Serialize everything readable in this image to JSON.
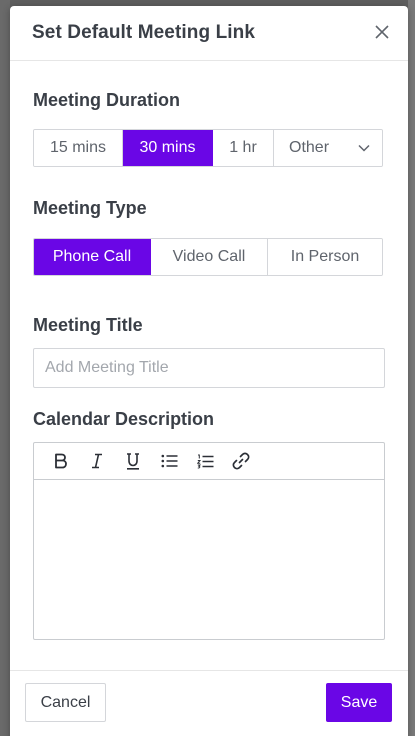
{
  "modal": {
    "title": "Set Default Meeting Link",
    "close_icon": "close-icon"
  },
  "duration": {
    "label": "Meeting Duration",
    "options": [
      "15 mins",
      "30 mins",
      "1 hr"
    ],
    "selected": "30 mins",
    "other_select": {
      "value": "Other",
      "icon": "chevron-down-icon"
    }
  },
  "type": {
    "label": "Meeting Type",
    "options": [
      "Phone Call",
      "Video Call",
      "In Person"
    ],
    "selected": "Phone Call"
  },
  "title_field": {
    "label": "Meeting Title",
    "placeholder": "Add Meeting Title",
    "value": ""
  },
  "description": {
    "label": "Calendar Description",
    "toolbar": [
      "bold-icon",
      "italic-icon",
      "underline-icon",
      "bulleted-list-icon",
      "numbered-list-icon",
      "link-icon"
    ],
    "value": ""
  },
  "footer": {
    "cancel_label": "Cancel",
    "save_label": "Save"
  },
  "colors": {
    "accent": "#6a06e6",
    "text": "#3a3f47",
    "border": "#d4d6da"
  }
}
